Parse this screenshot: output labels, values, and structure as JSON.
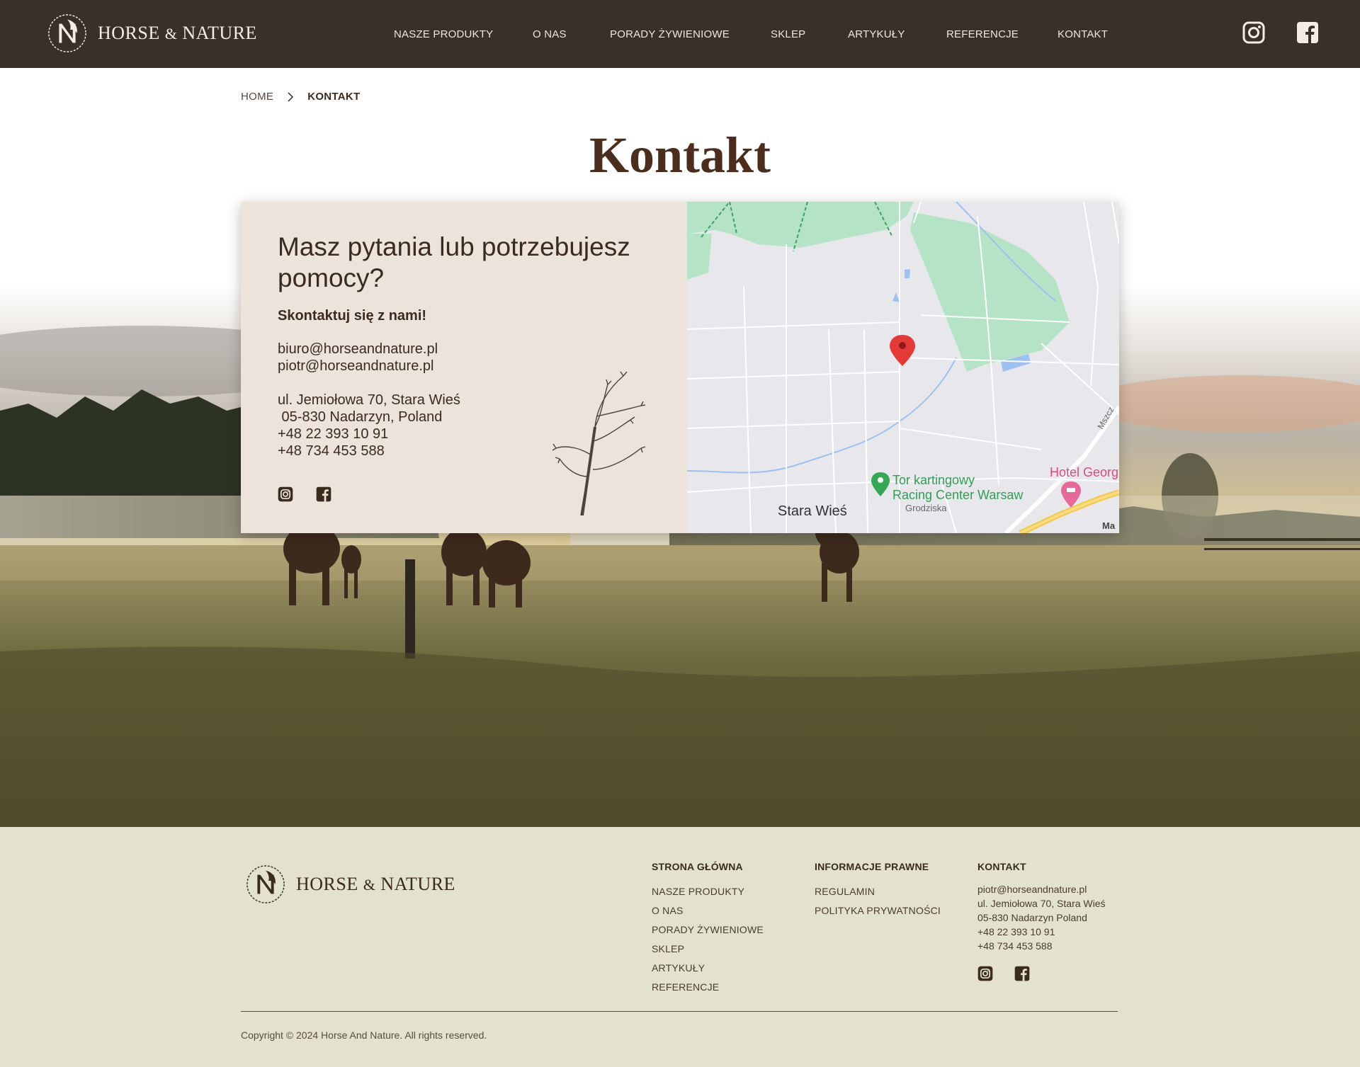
{
  "brand": {
    "name": "HORSE",
    "amp": "&",
    "name2": "NATURE"
  },
  "nav": {
    "items": [
      {
        "label": "NASZE PRODUKTY"
      },
      {
        "label": "O NAS"
      },
      {
        "label": "PORADY ŻYWIENIOWE"
      },
      {
        "label": "SKLEP"
      },
      {
        "label": "ARTYKUŁY"
      },
      {
        "label": "REFERENCJE"
      },
      {
        "label": "KONTAKT"
      }
    ],
    "social_icons": [
      "instagram-icon",
      "facebook-icon"
    ]
  },
  "breadcrumb": {
    "home": "HOME",
    "current": "KONTAKT"
  },
  "page_title": "Kontakt",
  "contact": {
    "heading": "Masz pytania lub potrzebujesz pomocy?",
    "subheading": "Skontaktuj się z nami!",
    "emails": [
      "biuro@horseandnature.pl",
      "piotr@horseandnature.pl"
    ],
    "address_lines": [
      "ul. Jemiołowa 70, Stara Wieś",
      " 05-830 Nadarzyn, Poland",
      "+48 22 393 10 91",
      "+48 734 453 588"
    ]
  },
  "map": {
    "place_1": "Tor kartingowy",
    "place_1b": "Racing Center Warsaw",
    "place_2": "Hotel Georg",
    "town": "Stara Wieś",
    "district": "Grodziska",
    "road": "Mszcz",
    "corner": "Ma"
  },
  "footer": {
    "col1": {
      "title": "STRONA GŁÓWNA",
      "links": [
        "NASZE PRODUKTY",
        "O NAS",
        "PORADY ŻYWIENIOWE",
        "SKLEP",
        "ARTYKUŁY",
        "REFERENCJE"
      ]
    },
    "col2": {
      "title": "INFORMACJE PRAWNE",
      "links": [
        "REGULAMIN",
        "POLITYKA PRYWATNOŚCI"
      ]
    },
    "col3": {
      "title": "KONTAKT",
      "lines": [
        "piotr@horseandnature.pl",
        "ul. Jemiołowa 70, Stara Wieś",
        "05-830 Nadarzyn Poland",
        "+48 22 393 10 91",
        "+48 734 453 588"
      ]
    },
    "copyright": "Copyright © 2024 Horse And Nature. All rights reserved."
  },
  "colors": {
    "header_bg": "#3b3029",
    "title_brown": "#4a2d1d",
    "card_bg": "#ece3da",
    "footer_bg": "#e3e2cf"
  }
}
